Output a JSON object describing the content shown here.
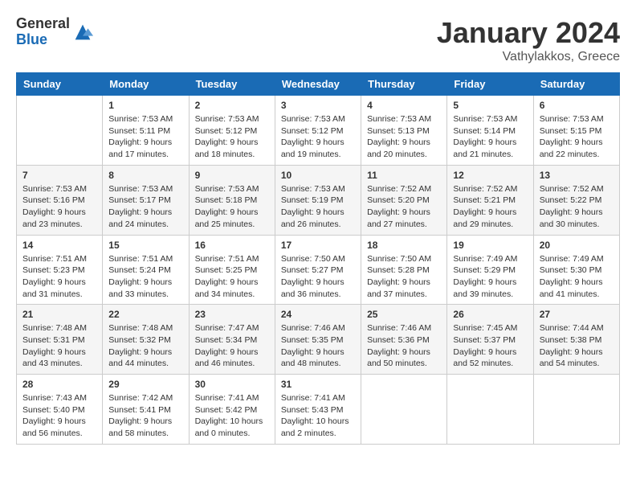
{
  "logo": {
    "general": "General",
    "blue": "Blue"
  },
  "title": "January 2024",
  "location": "Vathylakkos, Greece",
  "days_of_week": [
    "Sunday",
    "Monday",
    "Tuesday",
    "Wednesday",
    "Thursday",
    "Friday",
    "Saturday"
  ],
  "weeks": [
    [
      {
        "day": "",
        "sunrise": "",
        "sunset": "",
        "daylight": ""
      },
      {
        "day": "1",
        "sunrise": "Sunrise: 7:53 AM",
        "sunset": "Sunset: 5:11 PM",
        "daylight": "Daylight: 9 hours and 17 minutes."
      },
      {
        "day": "2",
        "sunrise": "Sunrise: 7:53 AM",
        "sunset": "Sunset: 5:12 PM",
        "daylight": "Daylight: 9 hours and 18 minutes."
      },
      {
        "day": "3",
        "sunrise": "Sunrise: 7:53 AM",
        "sunset": "Sunset: 5:12 PM",
        "daylight": "Daylight: 9 hours and 19 minutes."
      },
      {
        "day": "4",
        "sunrise": "Sunrise: 7:53 AM",
        "sunset": "Sunset: 5:13 PM",
        "daylight": "Daylight: 9 hours and 20 minutes."
      },
      {
        "day": "5",
        "sunrise": "Sunrise: 7:53 AM",
        "sunset": "Sunset: 5:14 PM",
        "daylight": "Daylight: 9 hours and 21 minutes."
      },
      {
        "day": "6",
        "sunrise": "Sunrise: 7:53 AM",
        "sunset": "Sunset: 5:15 PM",
        "daylight": "Daylight: 9 hours and 22 minutes."
      }
    ],
    [
      {
        "day": "7",
        "sunrise": "Sunrise: 7:53 AM",
        "sunset": "Sunset: 5:16 PM",
        "daylight": "Daylight: 9 hours and 23 minutes."
      },
      {
        "day": "8",
        "sunrise": "Sunrise: 7:53 AM",
        "sunset": "Sunset: 5:17 PM",
        "daylight": "Daylight: 9 hours and 24 minutes."
      },
      {
        "day": "9",
        "sunrise": "Sunrise: 7:53 AM",
        "sunset": "Sunset: 5:18 PM",
        "daylight": "Daylight: 9 hours and 25 minutes."
      },
      {
        "day": "10",
        "sunrise": "Sunrise: 7:53 AM",
        "sunset": "Sunset: 5:19 PM",
        "daylight": "Daylight: 9 hours and 26 minutes."
      },
      {
        "day": "11",
        "sunrise": "Sunrise: 7:52 AM",
        "sunset": "Sunset: 5:20 PM",
        "daylight": "Daylight: 9 hours and 27 minutes."
      },
      {
        "day": "12",
        "sunrise": "Sunrise: 7:52 AM",
        "sunset": "Sunset: 5:21 PM",
        "daylight": "Daylight: 9 hours and 29 minutes."
      },
      {
        "day": "13",
        "sunrise": "Sunrise: 7:52 AM",
        "sunset": "Sunset: 5:22 PM",
        "daylight": "Daylight: 9 hours and 30 minutes."
      }
    ],
    [
      {
        "day": "14",
        "sunrise": "Sunrise: 7:51 AM",
        "sunset": "Sunset: 5:23 PM",
        "daylight": "Daylight: 9 hours and 31 minutes."
      },
      {
        "day": "15",
        "sunrise": "Sunrise: 7:51 AM",
        "sunset": "Sunset: 5:24 PM",
        "daylight": "Daylight: 9 hours and 33 minutes."
      },
      {
        "day": "16",
        "sunrise": "Sunrise: 7:51 AM",
        "sunset": "Sunset: 5:25 PM",
        "daylight": "Daylight: 9 hours and 34 minutes."
      },
      {
        "day": "17",
        "sunrise": "Sunrise: 7:50 AM",
        "sunset": "Sunset: 5:27 PM",
        "daylight": "Daylight: 9 hours and 36 minutes."
      },
      {
        "day": "18",
        "sunrise": "Sunrise: 7:50 AM",
        "sunset": "Sunset: 5:28 PM",
        "daylight": "Daylight: 9 hours and 37 minutes."
      },
      {
        "day": "19",
        "sunrise": "Sunrise: 7:49 AM",
        "sunset": "Sunset: 5:29 PM",
        "daylight": "Daylight: 9 hours and 39 minutes."
      },
      {
        "day": "20",
        "sunrise": "Sunrise: 7:49 AM",
        "sunset": "Sunset: 5:30 PM",
        "daylight": "Daylight: 9 hours and 41 minutes."
      }
    ],
    [
      {
        "day": "21",
        "sunrise": "Sunrise: 7:48 AM",
        "sunset": "Sunset: 5:31 PM",
        "daylight": "Daylight: 9 hours and 43 minutes."
      },
      {
        "day": "22",
        "sunrise": "Sunrise: 7:48 AM",
        "sunset": "Sunset: 5:32 PM",
        "daylight": "Daylight: 9 hours and 44 minutes."
      },
      {
        "day": "23",
        "sunrise": "Sunrise: 7:47 AM",
        "sunset": "Sunset: 5:34 PM",
        "daylight": "Daylight: 9 hours and 46 minutes."
      },
      {
        "day": "24",
        "sunrise": "Sunrise: 7:46 AM",
        "sunset": "Sunset: 5:35 PM",
        "daylight": "Daylight: 9 hours and 48 minutes."
      },
      {
        "day": "25",
        "sunrise": "Sunrise: 7:46 AM",
        "sunset": "Sunset: 5:36 PM",
        "daylight": "Daylight: 9 hours and 50 minutes."
      },
      {
        "day": "26",
        "sunrise": "Sunrise: 7:45 AM",
        "sunset": "Sunset: 5:37 PM",
        "daylight": "Daylight: 9 hours and 52 minutes."
      },
      {
        "day": "27",
        "sunrise": "Sunrise: 7:44 AM",
        "sunset": "Sunset: 5:38 PM",
        "daylight": "Daylight: 9 hours and 54 minutes."
      }
    ],
    [
      {
        "day": "28",
        "sunrise": "Sunrise: 7:43 AM",
        "sunset": "Sunset: 5:40 PM",
        "daylight": "Daylight: 9 hours and 56 minutes."
      },
      {
        "day": "29",
        "sunrise": "Sunrise: 7:42 AM",
        "sunset": "Sunset: 5:41 PM",
        "daylight": "Daylight: 9 hours and 58 minutes."
      },
      {
        "day": "30",
        "sunrise": "Sunrise: 7:41 AM",
        "sunset": "Sunset: 5:42 PM",
        "daylight": "Daylight: 10 hours and 0 minutes."
      },
      {
        "day": "31",
        "sunrise": "Sunrise: 7:41 AM",
        "sunset": "Sunset: 5:43 PM",
        "daylight": "Daylight: 10 hours and 2 minutes."
      },
      {
        "day": "",
        "sunrise": "",
        "sunset": "",
        "daylight": ""
      },
      {
        "day": "",
        "sunrise": "",
        "sunset": "",
        "daylight": ""
      },
      {
        "day": "",
        "sunrise": "",
        "sunset": "",
        "daylight": ""
      }
    ]
  ]
}
